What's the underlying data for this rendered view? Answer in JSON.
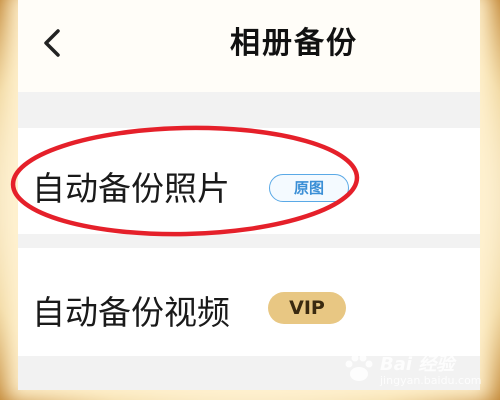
{
  "header": {
    "title": "相册备份"
  },
  "rows": [
    {
      "label": "自动备份照片",
      "badge": "原图"
    },
    {
      "label": "自动备份视频",
      "badge": "VIP"
    }
  ],
  "watermark": {
    "brand": "Bai 经验",
    "url": "jingyan.baidu.com"
  },
  "colors": {
    "annotation": "#e5202a",
    "badge_blue": "#3b8fd6",
    "vip_gold": "#e8c783",
    "separator": "#f2f2f2"
  },
  "icons": {
    "back": "chevron-left-icon",
    "watermark_logo": "paw-logo-icon"
  }
}
